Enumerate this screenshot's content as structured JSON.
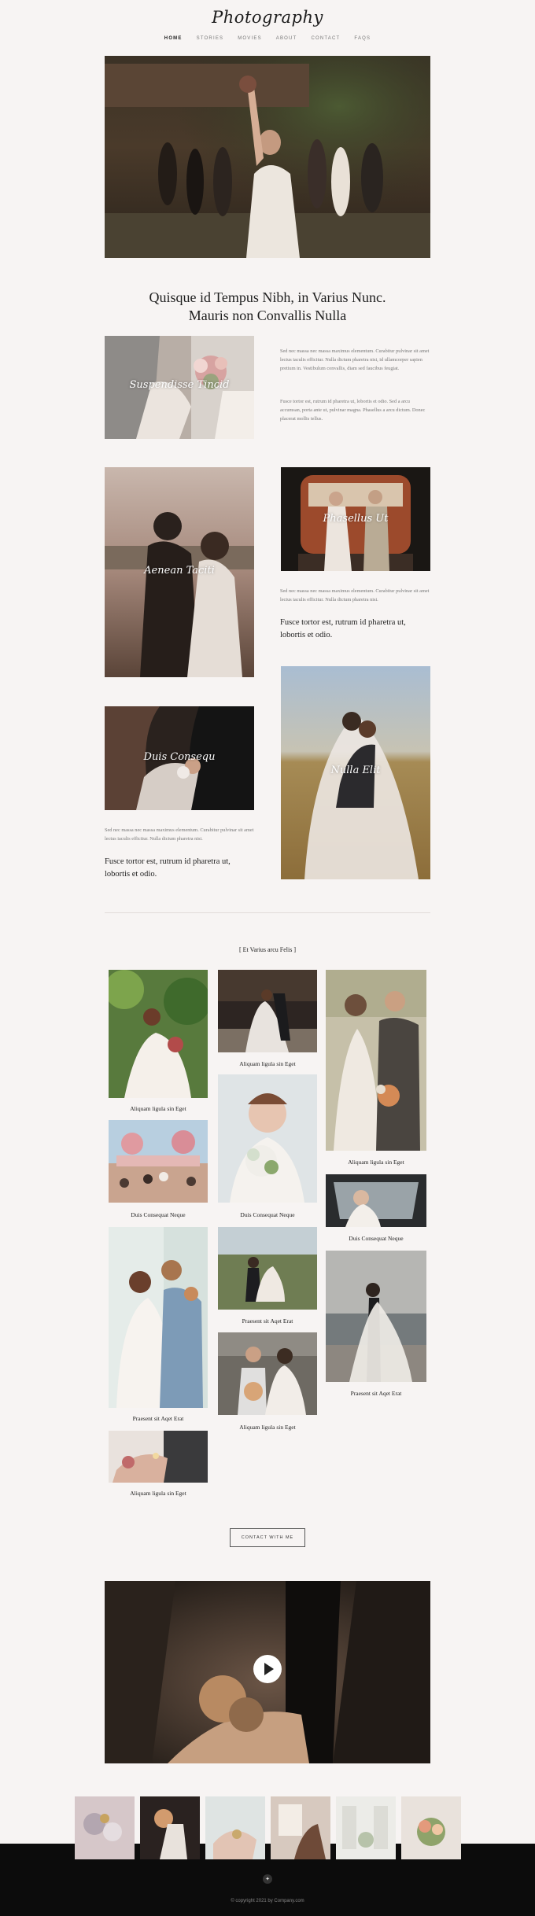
{
  "header": {
    "logo": "Photography",
    "nav": [
      "HOME",
      "STORIES",
      "MOVIES",
      "ABOUT",
      "CONTACT",
      "FAQS"
    ]
  },
  "intro": {
    "title_line1": "Quisque id Tempus Nibh, in Varius Nunc.",
    "title_line2": "Mauris non Convallis Nulla"
  },
  "stories": [
    {
      "title": "Suspendisse Tincid"
    },
    {
      "title": "Aenean Taciti"
    },
    {
      "title": "Phasellus Ut"
    },
    {
      "title": "Duis Consequ"
    },
    {
      "title": "Nulla Elit"
    }
  ],
  "texts": {
    "p1": "Sed nec massa nec massa maximus elementum. Curabitur pulvinar sit amet lectus iaculis efficitur. Nulla dictum pharetra nisi, id ullamcorper sapien pretium in. Vestibulum convallis, diam sed faucibus feugiat.",
    "p2": "Fusce tortor est, rutrum id pharetra ut, lobortis et odio. Sed a arcu accumsan, porta ante ut, pulvinar magna. Phasellus a arcu dictum. Donec placerat mollis tellus.",
    "p3": "Sed nec massa nec massa maximus elementum. Curabitur pulvinar sit amet lectus iaculis efficitur. Nulla dictum pharetra nisi.",
    "b1": "Fusce tortor est, rutrum id pharetra ut, lobortis et odio.",
    "p4": "Sed nec massa nec massa maximus elementum. Curabitur pulvinar sit amet lectus iaculis efficitur. Nulla dictum pharetra nisi.",
    "b2": "Fusce tortor est, rutrum id pharetra ut, lobortis et odio."
  },
  "gallery": {
    "heading": "[ Et Varius arcu Felis ]",
    "captions": {
      "c1": "Aliquam ligula sin Eget",
      "c2": "Duis Consequat Neque",
      "c3": "Praesent sit Aqet Erat",
      "c4": "Aliquam ligula sin Eget",
      "c5": "Aliquam ligula sin Eget",
      "c6": "Duis Consequat Neque",
      "c7": "Praesent sit Aqet Erat",
      "c8": "Aliquam ligula sin Eget",
      "c9": "Aliquam ligula sin Eget",
      "c10": "Duis Consequat Neque",
      "c11": "Praesent sit Aqet Erat"
    }
  },
  "cta": {
    "label": "CONTACT WITH ME"
  },
  "footer": {
    "copyright": "© copyright 2021 by Company.com",
    "social_icon": "twitter-icon"
  }
}
